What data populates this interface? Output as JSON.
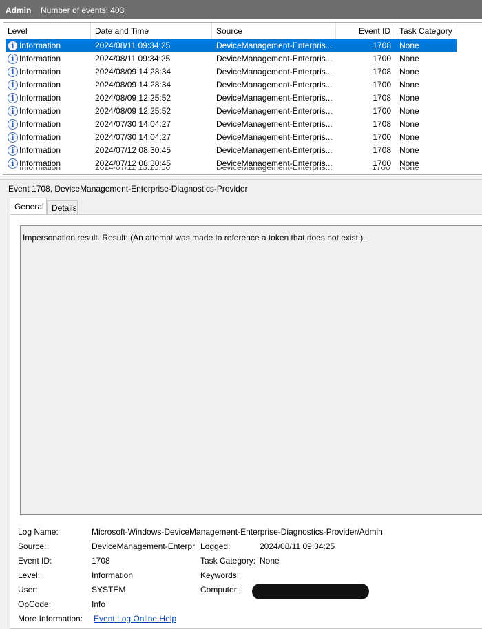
{
  "header": {
    "log_name": "Admin",
    "event_count": "Number of events: 403"
  },
  "columns": {
    "level": "Level",
    "date": "Date and Time",
    "source": "Source",
    "event_id": "Event ID",
    "task_category": "Task Category"
  },
  "rows": [
    {
      "level": "Information",
      "date": "2024/08/11 09:34:25",
      "source": "DeviceManagement-Enterpris...",
      "event_id": "1708",
      "task_category": "None",
      "selected": true
    },
    {
      "level": "Information",
      "date": "2024/08/11 09:34:25",
      "source": "DeviceManagement-Enterpris...",
      "event_id": "1700",
      "task_category": "None"
    },
    {
      "level": "Information",
      "date": "2024/08/09 14:28:34",
      "source": "DeviceManagement-Enterpris...",
      "event_id": "1708",
      "task_category": "None"
    },
    {
      "level": "Information",
      "date": "2024/08/09 14:28:34",
      "source": "DeviceManagement-Enterpris...",
      "event_id": "1700",
      "task_category": "None"
    },
    {
      "level": "Information",
      "date": "2024/08/09 12:25:52",
      "source": "DeviceManagement-Enterpris...",
      "event_id": "1708",
      "task_category": "None"
    },
    {
      "level": "Information",
      "date": "2024/08/09 12:25:52",
      "source": "DeviceManagement-Enterpris...",
      "event_id": "1700",
      "task_category": "None"
    },
    {
      "level": "Information",
      "date": "2024/07/30 14:04:27",
      "source": "DeviceManagement-Enterpris...",
      "event_id": "1708",
      "task_category": "None"
    },
    {
      "level": "Information",
      "date": "2024/07/30 14:04:27",
      "source": "DeviceManagement-Enterpris...",
      "event_id": "1700",
      "task_category": "None"
    },
    {
      "level": "Information",
      "date": "2024/07/12 08:30:45",
      "source": "DeviceManagement-Enterpris...",
      "event_id": "1708",
      "task_category": "None"
    },
    {
      "level": "Information",
      "date": "2024/07/12 08:30:45",
      "source": "DeviceManagement-Enterpris...",
      "event_id": "1700",
      "task_category": "None"
    }
  ],
  "icon": "information-icon",
  "detail": {
    "title": "Event 1708, DeviceManagement-Enterprise-Diagnostics-Provider",
    "tabs": {
      "general": "General",
      "details": "Details"
    },
    "message": "Impersonation result. Result: (An attempt was made to reference a token that does not exist.).",
    "labels": {
      "log_name": "Log Name:",
      "source": "Source:",
      "event_id": "Event ID:",
      "level": "Level:",
      "user": "User:",
      "opcode": "OpCode:",
      "more_info": "More Information:",
      "logged": "Logged:",
      "task_category": "Task Category:",
      "keywords": "Keywords:",
      "computer": "Computer:"
    },
    "values": {
      "log_name": "Microsoft-Windows-DeviceManagement-Enterprise-Diagnostics-Provider/Admin",
      "source": "DeviceManagement-Enterpr",
      "event_id": "1708",
      "level": "Information",
      "user": "SYSTEM",
      "opcode": "Info",
      "more_info_link": "Event Log Online Help",
      "logged": "2024/08/11 09:34:25",
      "task_category": "None",
      "keywords": ""
    }
  },
  "colors": {
    "selection": "#0078d7",
    "titlebar": "#6e6e6e",
    "link": "#0645ad"
  }
}
